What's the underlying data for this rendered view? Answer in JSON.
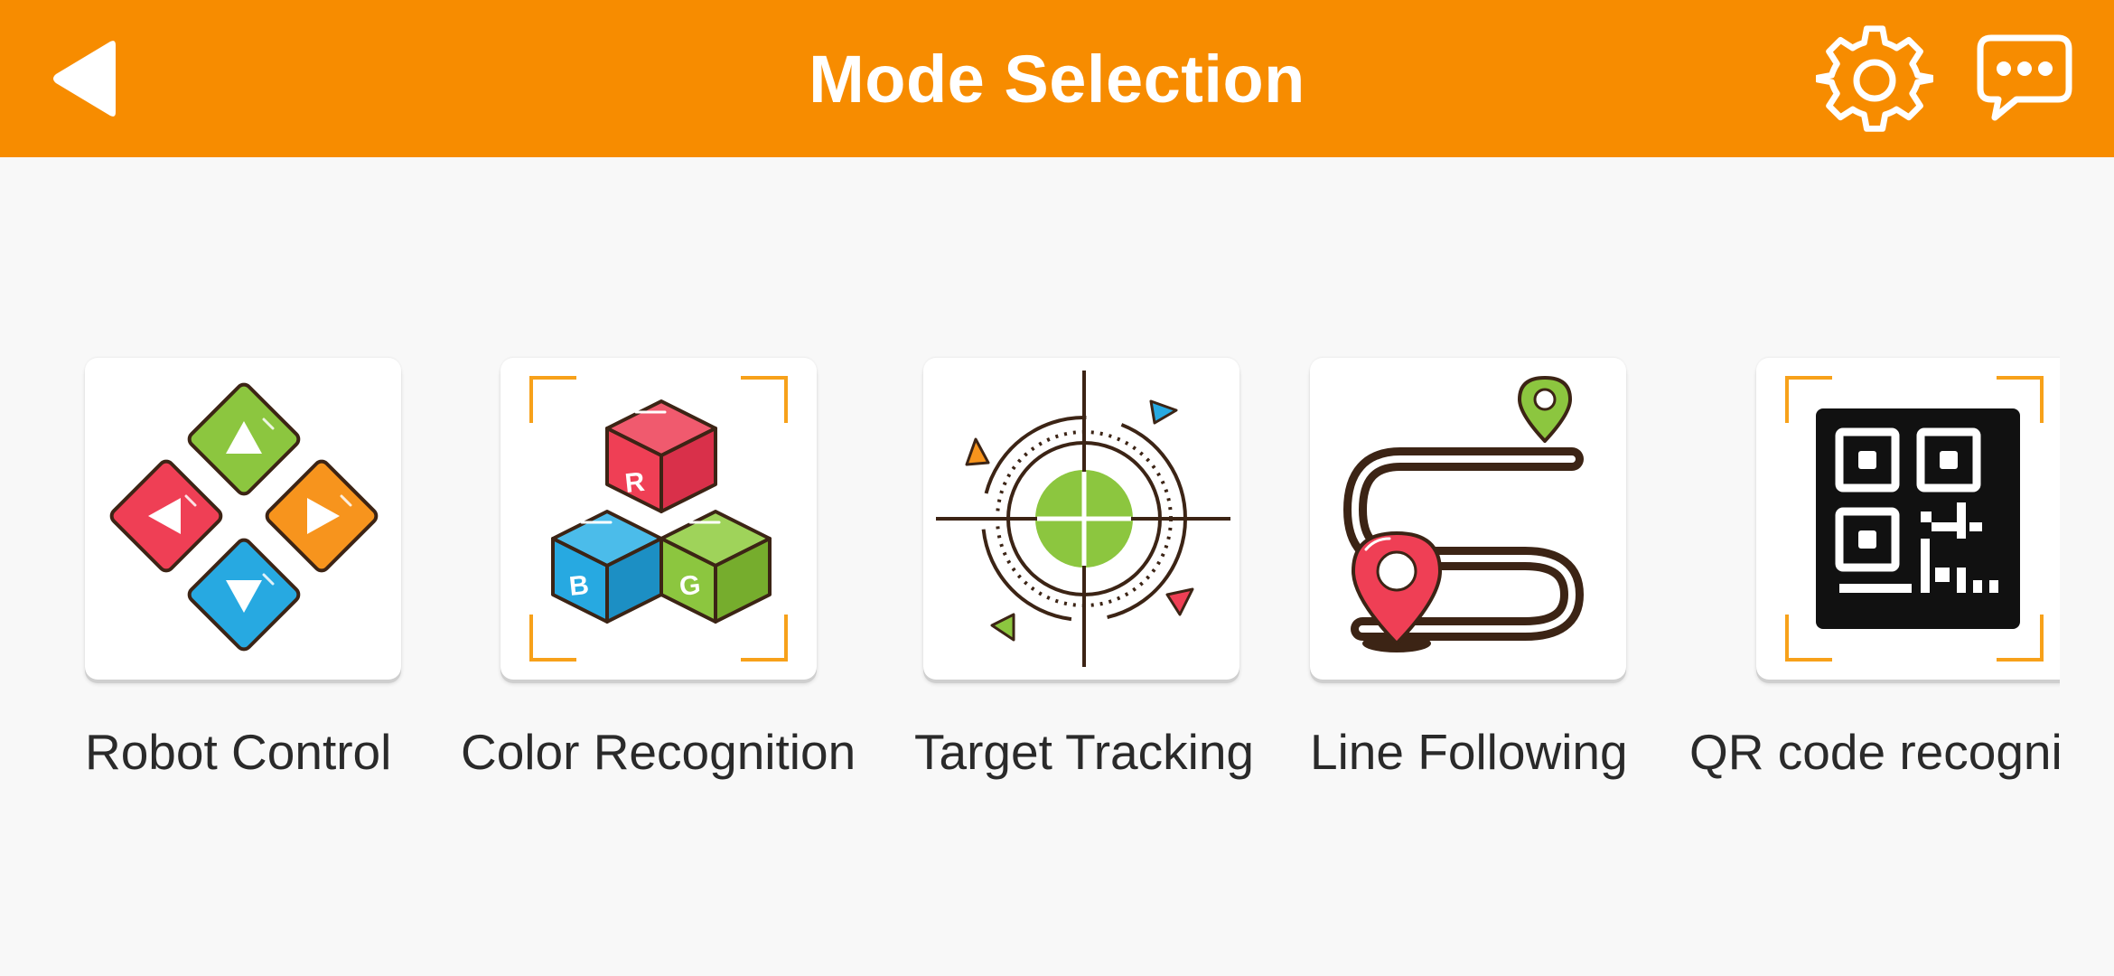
{
  "header": {
    "title": "Mode Selection",
    "back_icon": "back-triangle-icon",
    "settings_icon": "gear-icon",
    "messages_icon": "chat-bubble-icon"
  },
  "colors": {
    "header_bg": "#f78c00",
    "page_bg": "#f8f8f8",
    "green": "#8cc63f",
    "red": "#ef3f55",
    "blue": "#27a9e1",
    "orange": "#f7941d",
    "brown": "#3c2415"
  },
  "modes": [
    {
      "label": "Robot Control",
      "icon": "direction-pad-icon"
    },
    {
      "label": "Color Recognition",
      "icon": "rgb-cubes-icon"
    },
    {
      "label": "Target Tracking",
      "icon": "crosshair-target-icon"
    },
    {
      "label": "Line Following",
      "icon": "route-path-icon"
    },
    {
      "label": "QR code recogni",
      "icon": "qr-code-icon"
    }
  ]
}
